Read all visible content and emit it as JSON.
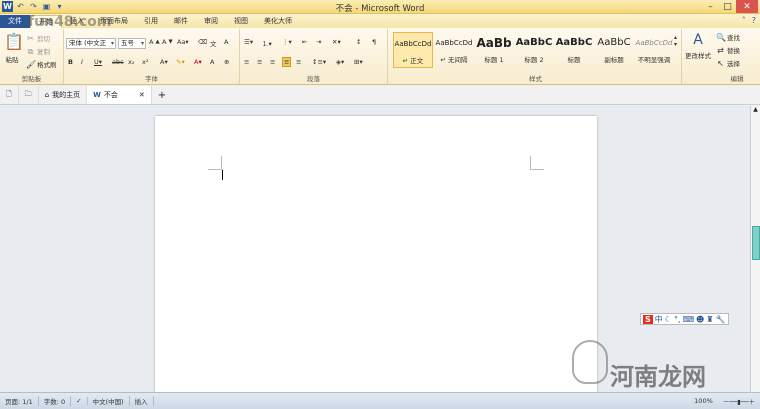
{
  "window": {
    "title": "不会 - Microsoft Word"
  },
  "tabs": [
    "文件",
    "开始",
    "插入",
    "页面布局",
    "引用",
    "邮件",
    "审阅",
    "视图",
    "美化大师"
  ],
  "clipboard": {
    "paste": "粘贴",
    "cut": "剪切",
    "copy": "复制",
    "format_painter": "格式刷",
    "label": "剪贴板"
  },
  "font": {
    "name": "宋体 (中文正",
    "size": "五号",
    "label": "字体"
  },
  "paragraph": {
    "label": "段落"
  },
  "styles": {
    "label": "样式",
    "items": [
      {
        "sample": "AaBbCcDd",
        "name": "↵ 正文"
      },
      {
        "sample": "AaBbCcDd",
        "name": "↵ 无间隔"
      },
      {
        "sample": "AaBb",
        "name": "标题 1"
      },
      {
        "sample": "AaBbC",
        "name": "标题 2"
      },
      {
        "sample": "AaBbC",
        "name": "标题"
      },
      {
        "sample": "AaBbC",
        "name": "副标题"
      },
      {
        "sample": "AaBbCcDd",
        "name": "不明显强调"
      }
    ],
    "change_styles": "更改样式"
  },
  "editing": {
    "find": "查找",
    "replace": "替换",
    "select": "选择",
    "label": "编辑"
  },
  "doc_tabs": {
    "home": "我的主页",
    "doc": "不会"
  },
  "status": {
    "page": "页面: 1/1",
    "words": "字数: 0",
    "lang": "中文(中国)",
    "mode": "插入",
    "zoom": "100%"
  },
  "watermarks": {
    "top": "fun48.com",
    "bottom": "河南龙网"
  }
}
